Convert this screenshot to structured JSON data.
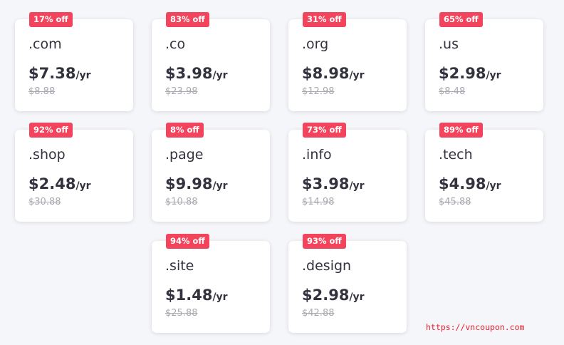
{
  "offers": [
    {
      "tld": ".com",
      "discount": "17% off",
      "price": "$7.38",
      "unit": "/yr",
      "old_price": "$8.88"
    },
    {
      "tld": ".co",
      "discount": "83% off",
      "price": "$3.98",
      "unit": "/yr",
      "old_price": "$23.98"
    },
    {
      "tld": ".org",
      "discount": "31% off",
      "price": "$8.98",
      "unit": "/yr",
      "old_price": "$12.98"
    },
    {
      "tld": ".us",
      "discount": "65% off",
      "price": "$2.98",
      "unit": "/yr",
      "old_price": "$8.48"
    },
    {
      "tld": ".shop",
      "discount": "92% off",
      "price": "$2.48",
      "unit": "/yr",
      "old_price": "$30.88"
    },
    {
      "tld": ".page",
      "discount": "8% off",
      "price": "$9.98",
      "unit": "/yr",
      "old_price": "$10.88"
    },
    {
      "tld": ".info",
      "discount": "73% off",
      "price": "$3.98",
      "unit": "/yr",
      "old_price": "$14.98"
    },
    {
      "tld": ".tech",
      "discount": "89% off",
      "price": "$4.98",
      "unit": "/yr",
      "old_price": "$45.88"
    },
    {
      "tld": ".site",
      "discount": "94% off",
      "price": "$1.48",
      "unit": "/yr",
      "old_price": "$25.88"
    },
    {
      "tld": ".design",
      "discount": "93% off",
      "price": "$2.98",
      "unit": "/yr",
      "old_price": "$42.88"
    }
  ],
  "watermark": "https://vncoupon.com",
  "colors": {
    "badge": "#f2445d",
    "watermark": "#e8202e",
    "background": "#f5f6fa"
  }
}
